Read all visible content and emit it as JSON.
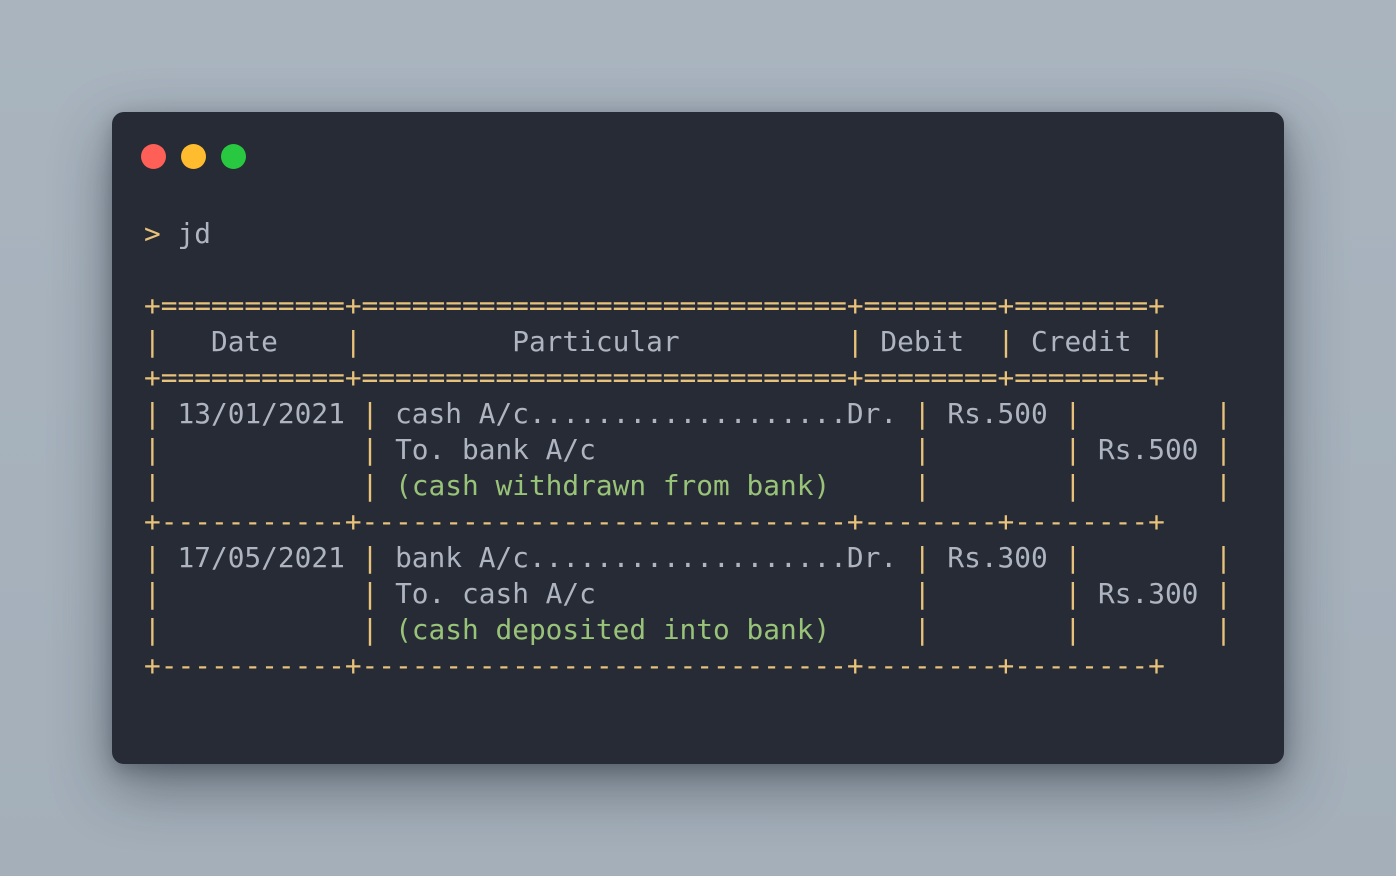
{
  "window": {
    "controls": [
      "close",
      "minimize",
      "maximize"
    ],
    "colors": {
      "close": "#fe5f57",
      "minimize": "#febc2e",
      "maximize": "#28c840",
      "background": "#272b35"
    }
  },
  "terminal": {
    "prompt": ">",
    "command": "jd",
    "table": {
      "header_border": "+===========+=============================+========+========+",
      "row_border": "+-----------+-----------------------------+--------+--------+",
      "headers": {
        "date": "   Date    ",
        "particular": "         Particular          ",
        "debit": " Debit  ",
        "credit": " Credit "
      },
      "rows": [
        {
          "date": " 13/01/2021 ",
          "lines": [
            {
              "particular": " cash A/c...................Dr. ",
              "debit": " Rs.500 ",
              "credit": "        "
            },
            {
              "particular": " To. bank A/c                ",
              "debit": "        ",
              "credit": " Rs.500 "
            },
            {
              "narration": " (cash withdrawn from bank)  "
            }
          ]
        },
        {
          "date": " 17/05/2021 ",
          "lines": [
            {
              "particular": " bank A/c...................Dr. ",
              "debit": " Rs.300 ",
              "credit": "        "
            },
            {
              "particular": " To. cash A/c                ",
              "debit": "        ",
              "credit": " Rs.300 "
            },
            {
              "narration": " (cash deposited into bank)  "
            }
          ]
        }
      ]
    },
    "colors": {
      "border": "#e8c27a",
      "text": "#aeb5c1",
      "narration": "#98c379"
    }
  }
}
